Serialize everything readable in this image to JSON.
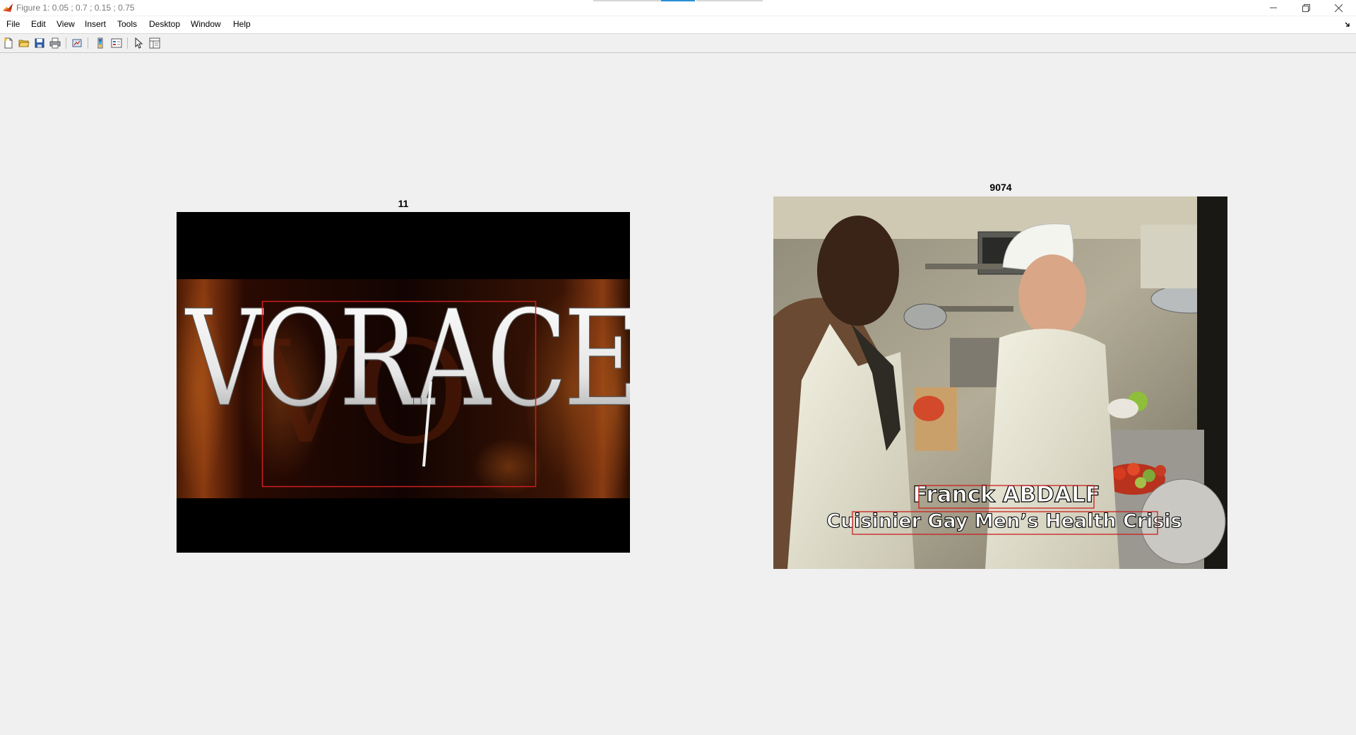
{
  "window": {
    "title": "Figure 1: 0.05 ; 0.7 ; 0.15 ; 0.75",
    "controls": [
      "minimize",
      "restore",
      "close"
    ]
  },
  "menu": {
    "items": [
      "File",
      "Edit",
      "View",
      "Insert",
      "Tools",
      "Desktop",
      "Window",
      "Help"
    ]
  },
  "toolbar": {
    "tools": [
      "new-figure",
      "open-file",
      "save-figure",
      "print-figure",
      "link-plot",
      "insert-colorbar",
      "insert-legend",
      "edit-plot",
      "property-inspector"
    ]
  },
  "figures": [
    {
      "title": "11",
      "image_text": "VORACE",
      "detection_box_color": "#cc1f1f"
    },
    {
      "title": "9074",
      "caption_name": "Franck  ABDALF",
      "caption_line": "Cuisinier Gay  Men’s Health Crisis",
      "detection_box_color": "#cc1f1f"
    }
  ]
}
